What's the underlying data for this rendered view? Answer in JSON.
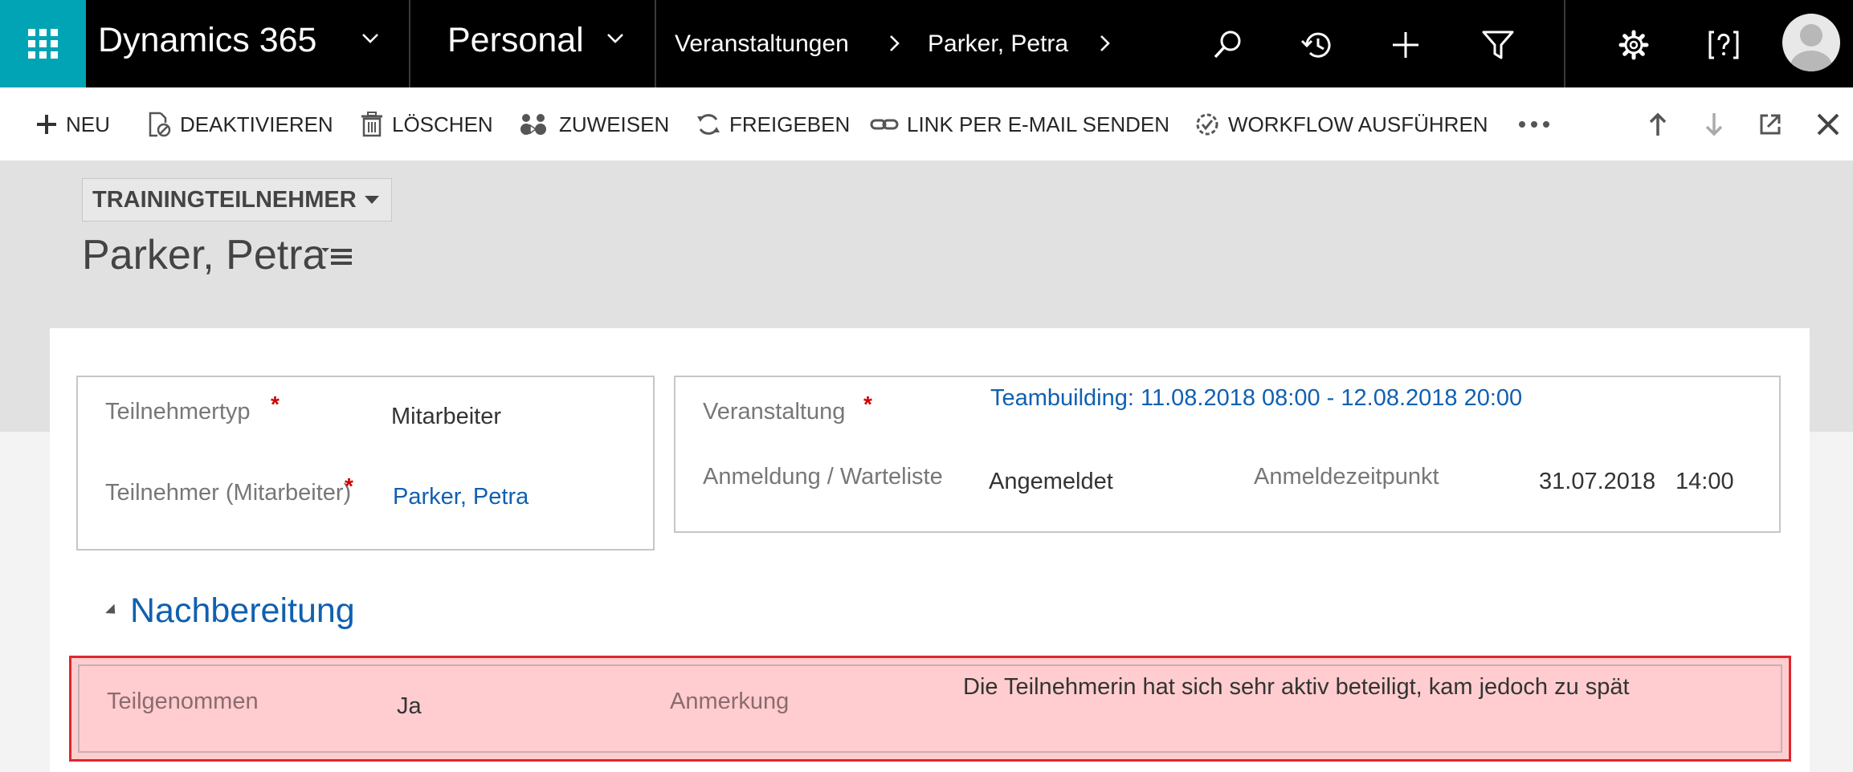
{
  "topbar": {
    "app_name": "Dynamics 365",
    "area": "Personal",
    "breadcrumbs": [
      "Veranstaltungen",
      "Parker, Petra"
    ]
  },
  "commands": {
    "new": "NEU",
    "deactivate": "DEAKTIVIEREN",
    "delete": "LÖSCHEN",
    "assign": "ZUWEISEN",
    "share": "FREIGEBEN",
    "email_link": "LINK PER E-MAIL SENDEN",
    "run_workflow": "WORKFLOW AUSFÜHREN"
  },
  "header": {
    "entity": "TRAININGTEILNEHMER",
    "record_title": "Parker, Petra"
  },
  "form": {
    "participant_type": {
      "label": "Teilnehmertyp",
      "value": "Mitarbeiter"
    },
    "participant": {
      "label": "Teilnehmer (Mitarbeiter)",
      "value": "Parker, Petra"
    },
    "event": {
      "label": "Veranstaltung",
      "value": "Teambuilding: 11.08.2018 08:00 - 12.08.2018 20:00"
    },
    "registration": {
      "label": "Anmeldung / Warteliste",
      "value": "Angemeldet"
    },
    "registration_time": {
      "label": "Anmeldezeitpunkt",
      "date": "31.07.2018",
      "time": "14:00"
    },
    "section_title": "Nachbereitung",
    "attended": {
      "label": "Teilgenommen",
      "value": "Ja"
    },
    "remark": {
      "label": "Anmerkung",
      "value": "Die Teilnehmerin hat sich sehr aktiv beteiligt, kam jedoch zu spät"
    }
  },
  "colors": {
    "waffle_bg": "#00a4b4",
    "link": "#1060b0",
    "highlight_border": "#e0262e",
    "highlight_fill": "#ffcdcf"
  }
}
